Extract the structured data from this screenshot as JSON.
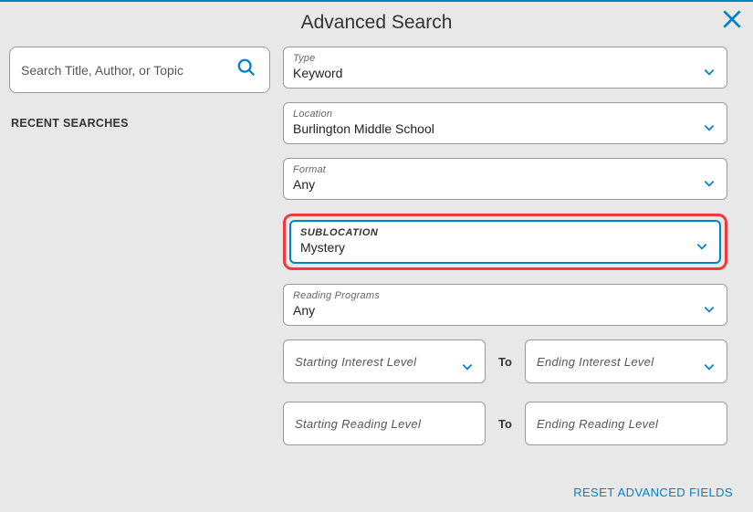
{
  "title": "Advanced Search",
  "search": {
    "placeholder": "Search Title, Author, or Topic"
  },
  "recentLabel": "RECENT SEARCHES",
  "fields": {
    "type": {
      "label": "Type",
      "value": "Keyword"
    },
    "location": {
      "label": "Location",
      "value": "Burlington Middle School"
    },
    "format": {
      "label": "Format",
      "value": "Any"
    },
    "sublocation": {
      "label": "SUBLOCATION",
      "value": "Mystery"
    },
    "readingPrograms": {
      "label": "Reading Programs",
      "value": "Any"
    }
  },
  "interestRange": {
    "start": "Starting Interest Level",
    "to": "To",
    "end": "Ending Interest Level"
  },
  "readingRange": {
    "start": "Starting Reading Level",
    "to": "To",
    "end": "Ending Reading Level"
  },
  "resetLabel": "RESET ADVANCED FIELDS"
}
